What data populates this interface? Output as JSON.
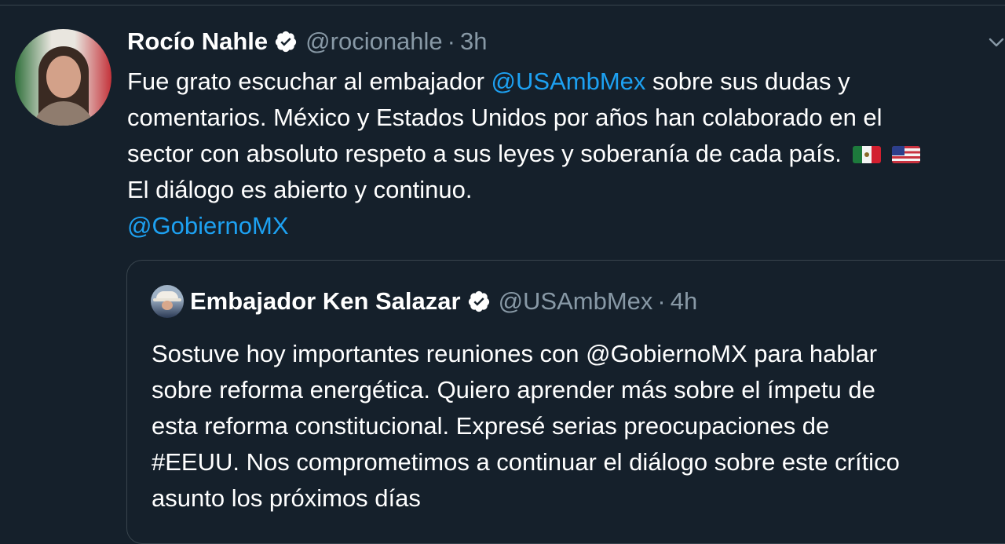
{
  "tweet": {
    "display_name": "Rocío Nahle",
    "handle": "@rocionahle",
    "separator": "·",
    "time": "3h",
    "text_lines": [
      {
        "before": "Fue grato escuchar al embajador ",
        "mention": "@USAmbMex",
        "after": " sobre sus dudas y"
      },
      {
        "text": "comentarios. México y Estados Unidos por años han colaborado en el"
      },
      {
        "text": "sector con absoluto respeto a sus leyes y soberanía de cada país."
      },
      {
        "text": "El diálogo es abierto y continuo."
      },
      {
        "mention": "@GobiernoMX"
      }
    ],
    "flags": [
      "mexico-flag",
      "usa-flag"
    ]
  },
  "quoted_tweet": {
    "display_name": "Embajador Ken Salazar",
    "handle": "@USAmbMex",
    "separator": "·",
    "time": "4h",
    "text_lines": [
      "Sostuve hoy importantes reuniones con @GobiernoMX para hablar",
      "sobre reforma energética. Quiero aprender más sobre el ímpetu de",
      "esta reforma constitucional. Expresé serias preocupaciones de",
      "#EEUU. Nos comprometimos a continuar el diálogo sobre este crítico",
      "asunto los próximos días"
    ]
  },
  "colors": {
    "background": "#15202b",
    "text_primary": "#ffffff",
    "text_secondary": "#8899a6",
    "link": "#1da1f2",
    "border": "#38444d"
  },
  "icons": {
    "verified": "verified-badge-icon",
    "menu": "chevron-down-icon"
  }
}
